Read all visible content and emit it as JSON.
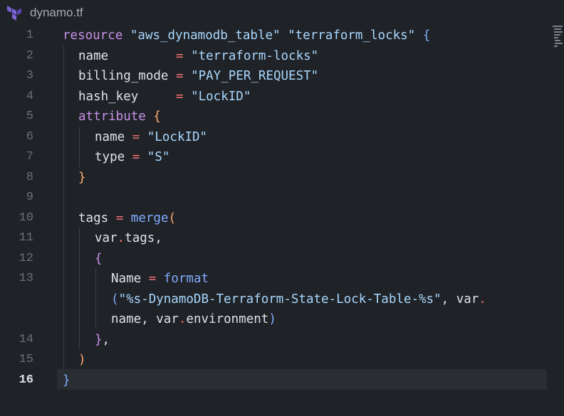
{
  "tab": {
    "title": "dynamo.tf",
    "icon": "terraform-icon"
  },
  "editor": {
    "active_line": "16",
    "line_numbers": [
      "1",
      "2",
      "3",
      "4",
      "5",
      "6",
      "7",
      "8",
      "9",
      "10",
      "11",
      "12",
      "13",
      "14",
      "15",
      "16"
    ],
    "code": {
      "l1": {
        "kw": "resource",
        "s1": "\"aws_dynamodb_table\"",
        "s2": "\"terraform_locks\"",
        "br": "{"
      },
      "l2": {
        "key": "name",
        "eq": "=",
        "val": "\"terraform-locks\""
      },
      "l3": {
        "key": "billing_mode",
        "eq": "=",
        "val": "\"PAY_PER_REQUEST\""
      },
      "l4": {
        "key": "hash_key",
        "eq": "=",
        "val": "\"LockID\""
      },
      "l5": {
        "kw": "attribute",
        "br": "{"
      },
      "l6": {
        "key": "name",
        "eq": "=",
        "val": "\"LockID\""
      },
      "l7": {
        "key": "type",
        "eq": "=",
        "val": "\"S\""
      },
      "l8": {
        "br": "}"
      },
      "l10": {
        "key": "tags",
        "eq": "=",
        "fn": "merge",
        "br": "("
      },
      "l11": {
        "obj": "var",
        "dot": ".",
        "prop": "tags",
        "comma": ","
      },
      "l12": {
        "br": "{"
      },
      "l13a": {
        "key": "Name",
        "eq": "=",
        "fn": "format"
      },
      "l13b": {
        "br": "(",
        "str": "\"%s-DynamoDB-Terraform-State-Lock-Table-%s\"",
        "comma": ",",
        "obj": "var",
        "dot": "."
      },
      "l13c": {
        "prop": "name",
        "comma": ",",
        "obj": "var",
        "dot": ".",
        "prop2": "environment",
        "br": ")"
      },
      "l14": {
        "br": "}",
        "comma": ","
      },
      "l15": {
        "br": ")"
      },
      "l16": {
        "br": "}"
      }
    }
  },
  "colors": {
    "background": "#1f2226",
    "keyword": "#c792ea",
    "string": "#a9d7ff",
    "operator": "#f07178",
    "function": "#82aaff",
    "bracket_orange": "#ffab70",
    "text": "#dfe2e7",
    "line_number": "#6b7079"
  }
}
